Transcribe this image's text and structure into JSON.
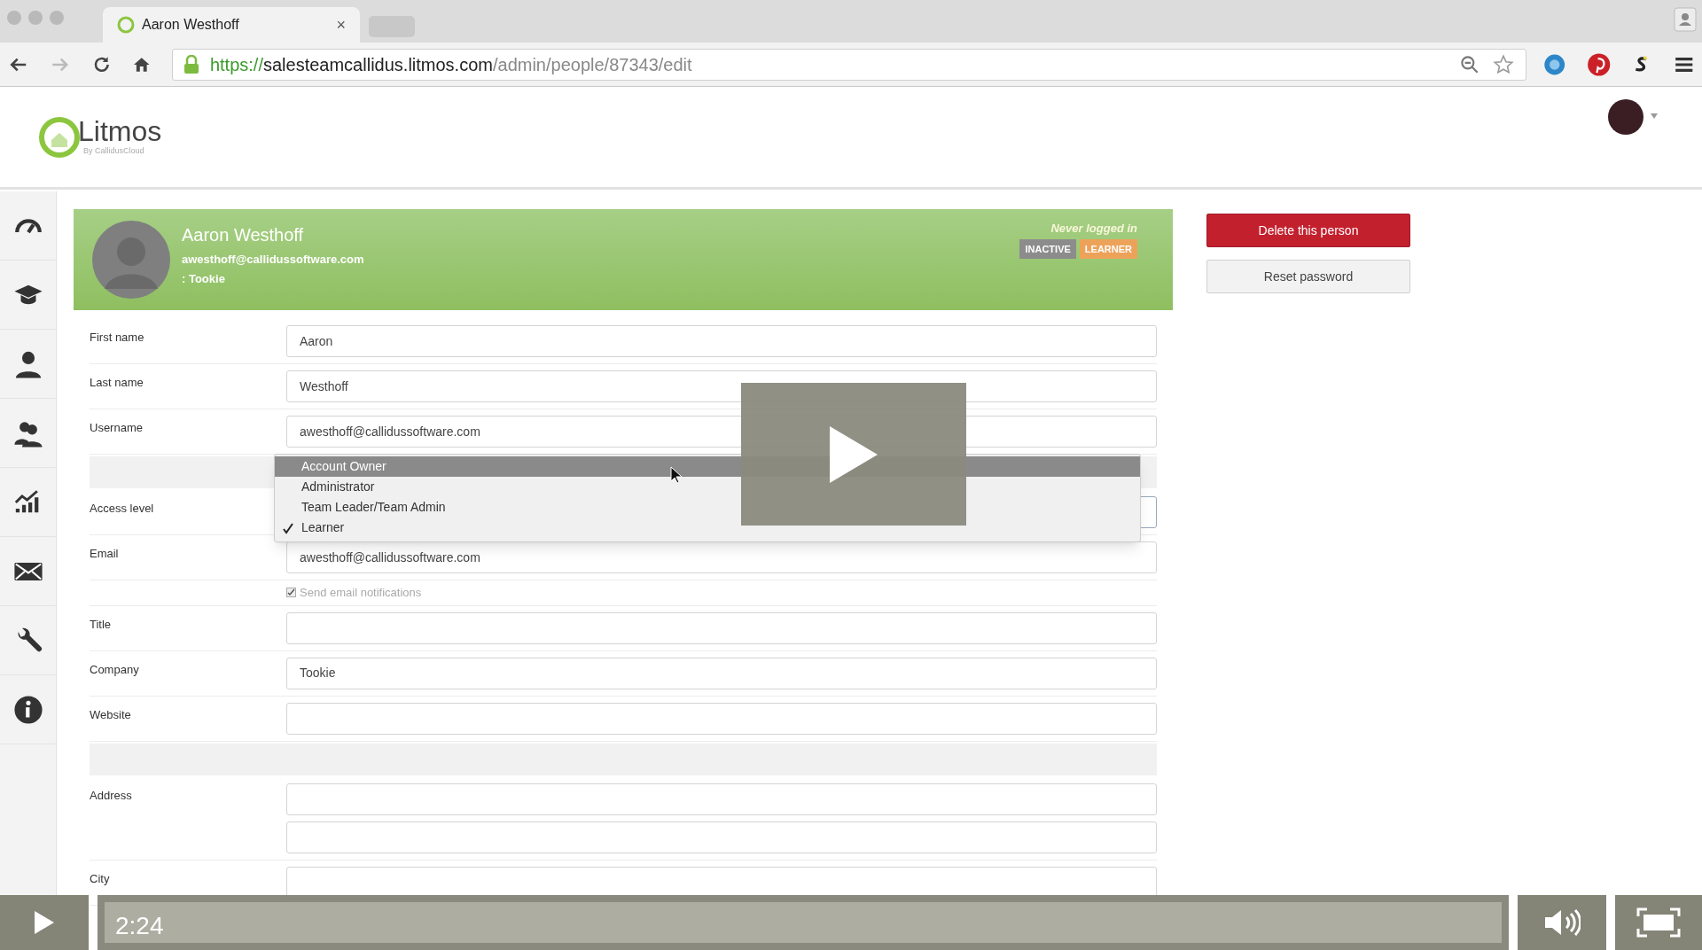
{
  "browser": {
    "tab": {
      "title": "Aaron Westhoff",
      "close": "×"
    },
    "url": {
      "scheme": "https://",
      "host": "salesteamcallidus.litmos.com",
      "path": "/admin/people/87343/edit"
    }
  },
  "header": {
    "logo": "Litmos",
    "logo_subtitle": "By CallidusCloud"
  },
  "profile": {
    "name": "Aaron Westhoff",
    "email": "awesthoff@callidussoftware.com",
    "company": ": Tookie",
    "login_status": "Never logged in",
    "badges": [
      {
        "label": "INACTIVE",
        "color": "#8c8c8c"
      },
      {
        "label": "LEARNER",
        "color": "#eda25a"
      }
    ]
  },
  "actions": [
    {
      "label": "Delete this person",
      "kind": "danger"
    },
    {
      "label": "Reset password",
      "kind": "default"
    }
  ],
  "form": [
    {
      "kind": "text",
      "label": "First name",
      "value": "Aaron"
    },
    {
      "kind": "text",
      "label": "Last name",
      "value": "Westhoff"
    },
    {
      "kind": "text",
      "label": "Username",
      "value": "awesthoff@callidussoftware.com"
    },
    {
      "kind": "separator"
    },
    {
      "kind": "select",
      "label": "Access level"
    },
    {
      "kind": "text",
      "label": "Email",
      "value": "awesthoff@callidussoftware.com"
    },
    {
      "kind": "checkbox",
      "label": "Send email notifications",
      "checked": true
    },
    {
      "kind": "text",
      "label": "Title"
    },
    {
      "kind": "text",
      "label": "Company",
      "value": "Tookie"
    },
    {
      "kind": "text",
      "label": "Website"
    },
    {
      "kind": "separator"
    },
    {
      "kind": "double",
      "label": "Address"
    },
    {
      "kind": "text",
      "label": "City"
    }
  ],
  "dropdown": [
    {
      "label": "Account Owner",
      "highlighted": true,
      "checked": false
    },
    {
      "label": "Administrator",
      "highlighted": false,
      "checked": false
    },
    {
      "label": "Team Leader/Team Admin",
      "highlighted": false,
      "checked": false
    },
    {
      "label": "Learner",
      "highlighted": false,
      "checked": true
    }
  ],
  "video": {
    "time": "2:24",
    "level": 1
  }
}
